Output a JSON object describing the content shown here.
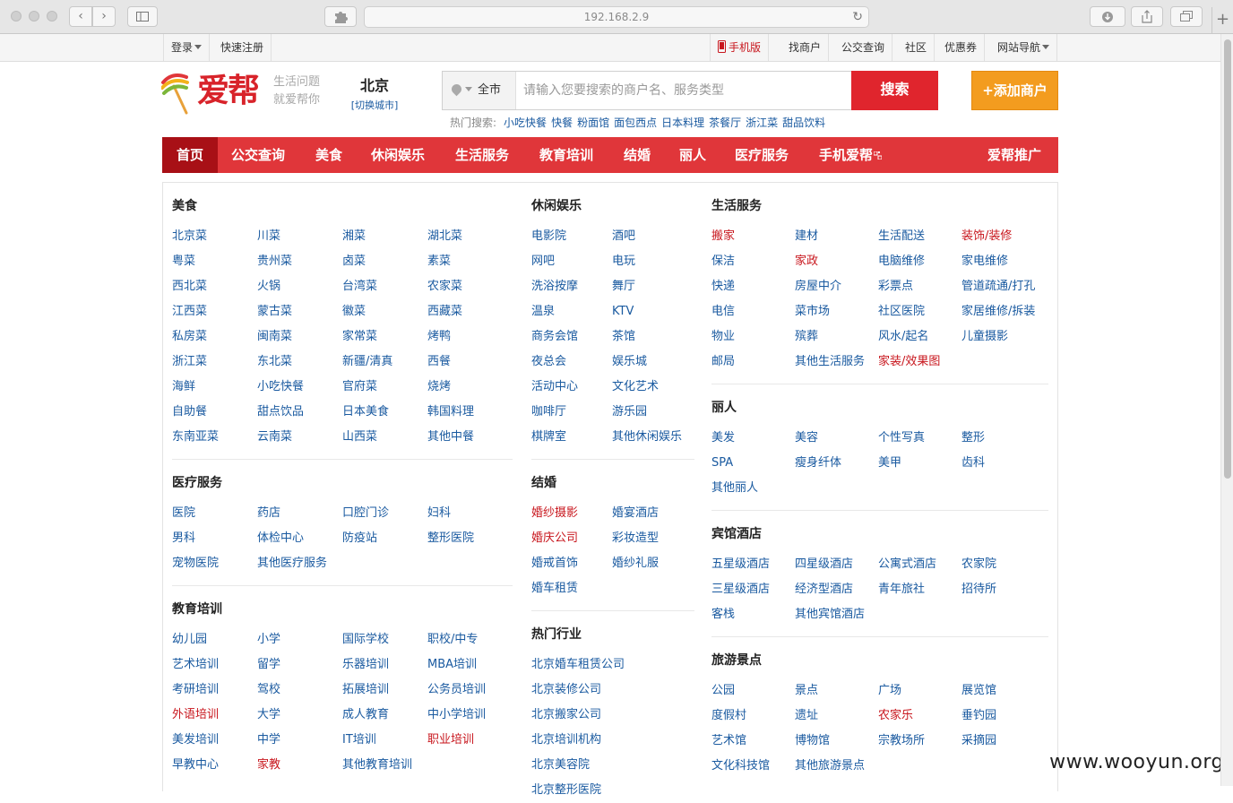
{
  "browser": {
    "url": "192.168.2.9"
  },
  "topbar": {
    "login": "登录",
    "register": "快速注册",
    "mobile": "手机版",
    "links": [
      "找商户",
      "公交查询",
      "社区",
      "优惠券"
    ],
    "site_nav": "网站导航"
  },
  "header": {
    "logo_text": "爱帮",
    "slogan_1": "生活问题",
    "slogan_2": "就爱帮你",
    "city": "北京",
    "switch_city": "[切换城市]",
    "scope": "全市",
    "search_placeholder": "请输入您要搜索的商户名、服务类型",
    "search_button": "搜索",
    "add_merchant": "+添加商户",
    "hot_label": "热门搜索:",
    "hot_keywords": [
      "小吃快餐",
      "快餐",
      "粉面馆",
      "面包西点",
      "日本料理",
      "茶餐厅",
      "浙江菜",
      "甜品饮料"
    ]
  },
  "nav": {
    "home": "首页",
    "items": [
      "公交查询",
      "美食",
      "休闲娱乐",
      "生活服务",
      "教育培训",
      "结婚",
      "丽人",
      "医疗服务",
      "手机爱帮"
    ],
    "promo": "爱帮推广"
  },
  "sections": {
    "food": {
      "title": "美食",
      "items": [
        "北京菜",
        "川菜",
        "湘菜",
        "湖北菜",
        "粤菜",
        "贵州菜",
        "卤菜",
        "素菜",
        "西北菜",
        "火锅",
        "台湾菜",
        "农家菜",
        "江西菜",
        "蒙古菜",
        "徽菜",
        "西藏菜",
        "私房菜",
        "闽南菜",
        "家常菜",
        "烤鸭",
        "浙江菜",
        "东北菜",
        "新疆/清真",
        "西餐",
        "海鲜",
        "小吃快餐",
        "官府菜",
        "烧烤",
        "自助餐",
        "甜点饮品",
        "日本美食",
        "韩国料理",
        "东南亚菜",
        "云南菜",
        "山西菜",
        "其他中餐"
      ]
    },
    "medical": {
      "title": "医疗服务",
      "items": [
        "医院",
        "药店",
        "口腔门诊",
        "妇科",
        "男科",
        "体检中心",
        "防疫站",
        "整形医院",
        "宠物医院",
        "其他医疗服务"
      ]
    },
    "education": {
      "title": "教育培训",
      "items": [
        "幼儿园",
        "小学",
        "国际学校",
        "职校/中专",
        "艺术培训",
        "留学",
        "乐器培训",
        "MBA培训",
        "考研培训",
        "驾校",
        "拓展培训",
        "公务员培训",
        "外语培训",
        "大学",
        "成人教育",
        "中小学培训",
        "美发培训",
        "中学",
        "IT培训",
        "职业培训",
        "早教中心",
        "家教",
        "其他教育培训"
      ]
    },
    "leisure": {
      "title": "休闲娱乐",
      "items": [
        "电影院",
        "酒吧",
        "网吧",
        "电玩",
        "洗浴按摩",
        "舞厅",
        "温泉",
        "KTV",
        "商务会馆",
        "茶馆",
        "夜总会",
        "娱乐城",
        "活动中心",
        "文化艺术",
        "咖啡厅",
        "游乐园",
        "棋牌室",
        "其他休闲娱乐"
      ]
    },
    "wedding": {
      "title": "结婚",
      "items": [
        "婚纱摄影",
        "婚宴酒店",
        "婚庆公司",
        "彩妆造型",
        "婚戒首饰",
        "婚纱礼服",
        "婚车租赁"
      ]
    },
    "hot_industry": {
      "title": "热门行业",
      "items": [
        "北京婚车租赁公司",
        "北京装修公司",
        "北京搬家公司",
        "北京培训机构",
        "北京美容院",
        "北京整形医院"
      ]
    },
    "life": {
      "title": "生活服务",
      "items": [
        "搬家",
        "建材",
        "生活配送",
        "装饰/装修",
        "保洁",
        "家政",
        "电脑维修",
        "家电维修",
        "快递",
        "房屋中介",
        "彩票点",
        "管道疏通/打孔",
        "电信",
        "菜市场",
        "社区医院",
        "家居维修/拆装",
        "物业",
        "殡葬",
        "风水/起名",
        "儿童摄影",
        "邮局",
        "其他生活服务",
        "家装/效果图"
      ]
    },
    "beauty": {
      "title": "丽人",
      "items": [
        "美发",
        "美容",
        "个性写真",
        "整形",
        "SPA",
        "瘦身纤体",
        "美甲",
        "齿科",
        "其他丽人"
      ]
    },
    "hotel": {
      "title": "宾馆酒店",
      "items": [
        "五星级酒店",
        "四星级酒店",
        "公寓式酒店",
        "农家院",
        "三星级酒店",
        "经济型酒店",
        "青年旅社",
        "招待所",
        "客栈",
        "其他宾馆酒店"
      ]
    },
    "travel": {
      "title": "旅游景点",
      "items": [
        "公园",
        "景点",
        "广场",
        "展览馆",
        "度假村",
        "遗址",
        "农家乐",
        "垂钓园",
        "艺术馆",
        "博物馆",
        "宗教场所",
        "采摘园",
        "文化科技馆",
        "其他旅游景点"
      ]
    }
  },
  "highlighted": [
    "外语培训",
    "职业培训",
    "家教",
    "婚纱摄影",
    "婚庆公司",
    "搬家",
    "装饰/装修",
    "家政",
    "家装/效果图",
    "农家乐"
  ],
  "watermark": "www.wooyun.org",
  "colors": {
    "brand_red": "#e0363a",
    "nav_active": "#a81016",
    "link_blue": "#1a5aa0",
    "add_orange": "#f39c1f"
  }
}
